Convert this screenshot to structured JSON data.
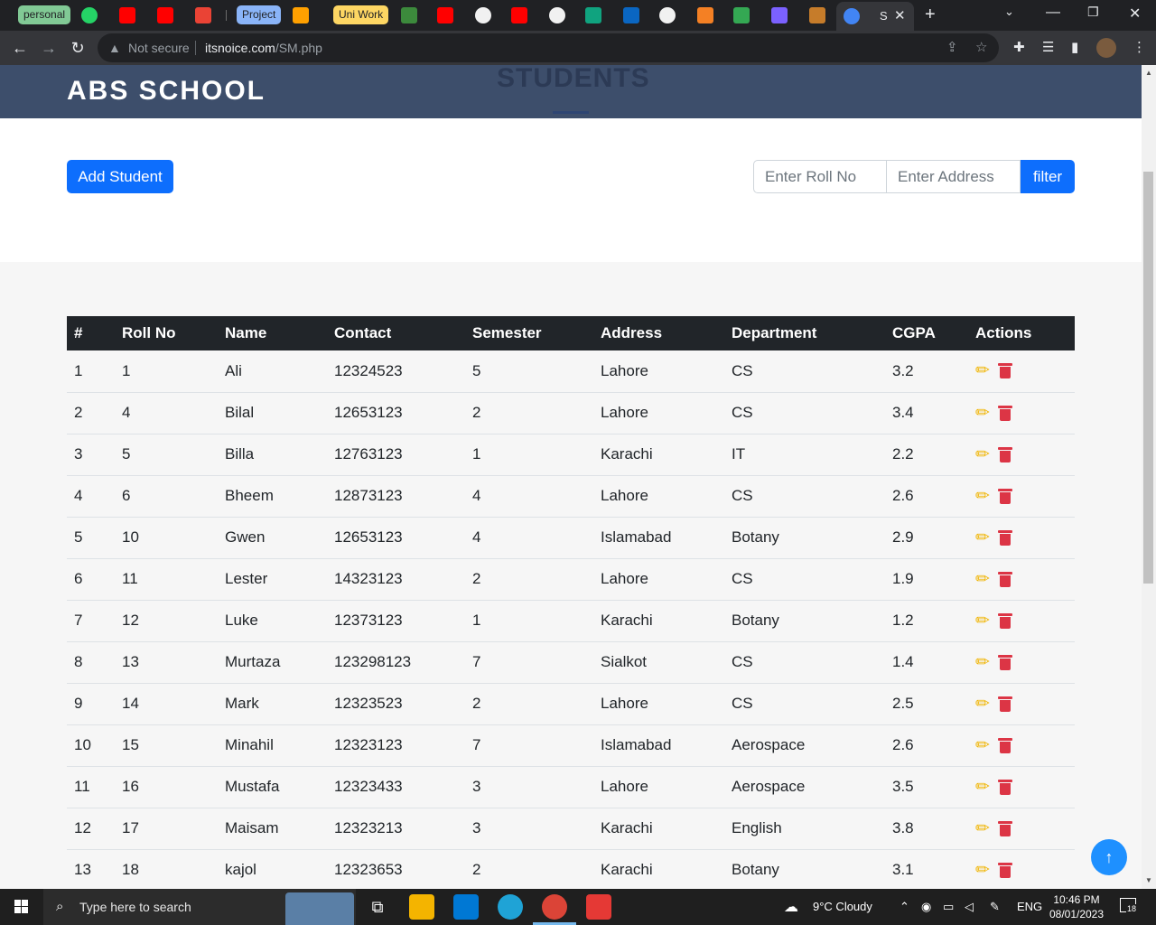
{
  "browser": {
    "tab_groups": [
      "personal",
      "Project",
      "Uni Work"
    ],
    "active_tab_label": "S",
    "security_label": "Not secure",
    "url_domain": "itsnoice.com",
    "url_path": "/SM.php"
  },
  "site": {
    "brand": "ABS SCHOOL",
    "hero_title": "STUDENTS"
  },
  "controls": {
    "add_label": "Add Student",
    "roll_placeholder": "Enter Roll No",
    "address_placeholder": "Enter Address",
    "filter_label": "filter"
  },
  "table": {
    "headers": [
      "#",
      "Roll No",
      "Name",
      "Contact",
      "Semester",
      "Address",
      "Department",
      "CGPA",
      "Actions"
    ],
    "rows": [
      [
        "1",
        "1",
        "Ali",
        "12324523",
        "5",
        "Lahore",
        "CS",
        "3.2"
      ],
      [
        "2",
        "4",
        "Bilal",
        "12653123",
        "2",
        "Lahore",
        "CS",
        "3.4"
      ],
      [
        "3",
        "5",
        "Billa",
        "12763123",
        "1",
        "Karachi",
        "IT",
        "2.2"
      ],
      [
        "4",
        "6",
        "Bheem",
        "12873123",
        "4",
        "Lahore",
        "CS",
        "2.6"
      ],
      [
        "5",
        "10",
        "Gwen",
        "12653123",
        "4",
        "Islamabad",
        "Botany",
        "2.9"
      ],
      [
        "6",
        "11",
        "Lester",
        "14323123",
        "2",
        "Lahore",
        "CS",
        "1.9"
      ],
      [
        "7",
        "12",
        "Luke",
        "12373123",
        "1",
        "Karachi",
        "Botany",
        "1.2"
      ],
      [
        "8",
        "13",
        "Murtaza",
        "123298123",
        "7",
        "Sialkot",
        "CS",
        "1.4"
      ],
      [
        "9",
        "14",
        "Mark",
        "12323523",
        "2",
        "Lahore",
        "CS",
        "2.5"
      ],
      [
        "10",
        "15",
        "Minahil",
        "12323123",
        "7",
        "Islamabad",
        "Aerospace",
        "2.6"
      ],
      [
        "11",
        "16",
        "Mustafa",
        "12323433",
        "3",
        "Lahore",
        "Aerospace",
        "3.5"
      ],
      [
        "12",
        "17",
        "Maisam",
        "12323213",
        "3",
        "Karachi",
        "English",
        "3.8"
      ],
      [
        "13",
        "18",
        "kajol",
        "12323653",
        "2",
        "Karachi",
        "Botany",
        "3.1"
      ]
    ]
  },
  "taskbar": {
    "search_placeholder": "Type here to search",
    "weather": "9°C  Cloudy",
    "language": "ENG",
    "time": "10:46 PM",
    "date": "08/01/2023",
    "notifications": "18"
  },
  "colors": {
    "header_bg": "#3d4e6b",
    "primary": "#0d6efd",
    "edit_icon": "#f0b400",
    "delete_icon": "#dc3545",
    "table_head": "#212529"
  },
  "icons": [
    "pencil-icon",
    "trash-icon",
    "arrow-up-icon",
    "search-icon",
    "windows-icon",
    "cloud-icon"
  ]
}
